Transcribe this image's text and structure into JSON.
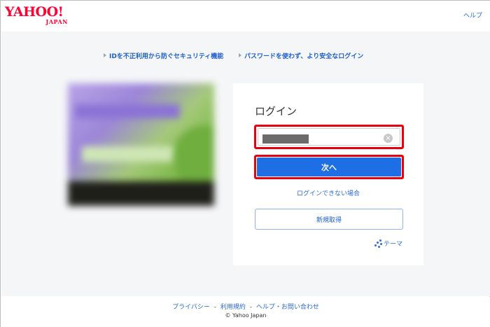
{
  "header": {
    "logo_main": "YAHOO!",
    "logo_sub": "JAPAN",
    "help_label": "ヘルプ"
  },
  "features": [
    {
      "label": "IDを不正利用から防ぐセキュリティ機能"
    },
    {
      "label": "パスワードを使わず、より安全なログイン"
    }
  ],
  "login": {
    "title": "ログイン",
    "id_input": {
      "value": "",
      "masked": true
    },
    "next_label": "次へ",
    "cant_login_label": "ログインできない場合",
    "signup_label": "新規取得",
    "theme_label": "テーマ"
  },
  "footer": {
    "links": [
      {
        "label": "プライバシー"
      },
      {
        "label": "利用規約"
      },
      {
        "label": "ヘルプ・お問い合わせ"
      }
    ],
    "separator": "-",
    "copyright": "© Yahoo Japan"
  },
  "colors": {
    "brand_red": "#ff0033",
    "primary_blue": "#1e6fe6",
    "link_blue": "#2a6bd8",
    "highlight_red": "#e60012",
    "page_bg": "#f5f6f8"
  }
}
